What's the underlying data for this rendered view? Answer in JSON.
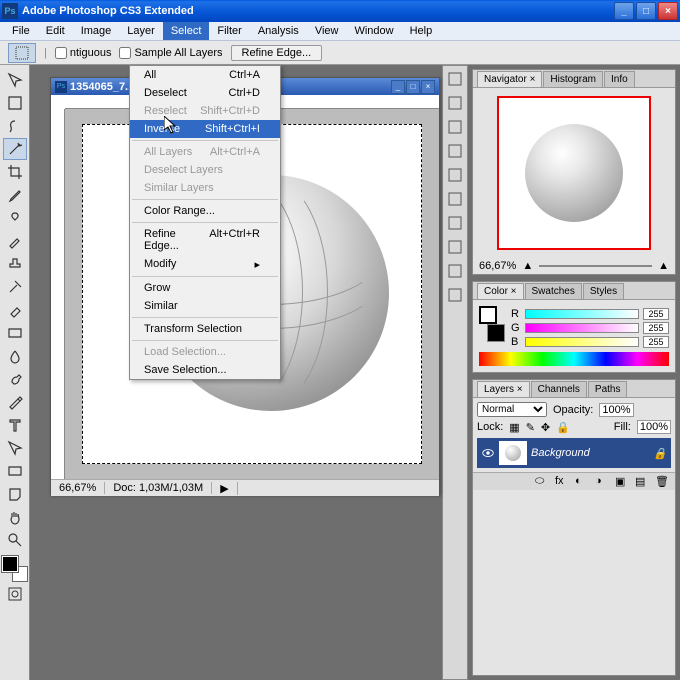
{
  "app": {
    "title": "Adobe Photoshop CS3 Extended",
    "icon": "Ps"
  },
  "menubar": [
    "File",
    "Edit",
    "Image",
    "Layer",
    "Select",
    "Filter",
    "Analysis",
    "View",
    "Window",
    "Help"
  ],
  "menubar_open_index": 4,
  "options": {
    "contiguous": "ntiguous",
    "sample_all": "Sample All Layers",
    "refine": "Refine Edge..."
  },
  "dropdown": [
    {
      "label": "All",
      "shortcut": "Ctrl+A"
    },
    {
      "label": "Deselect",
      "shortcut": "Ctrl+D"
    },
    {
      "label": "Reselect",
      "shortcut": "Shift+Ctrl+D",
      "disabled": true
    },
    {
      "label": "Inverse",
      "shortcut": "Shift+Ctrl+I",
      "highlight": true
    },
    {
      "sep": true
    },
    {
      "label": "All Layers",
      "shortcut": "Alt+Ctrl+A",
      "disabled": true
    },
    {
      "label": "Deselect Layers",
      "disabled": true
    },
    {
      "label": "Similar Layers",
      "disabled": true
    },
    {
      "sep": true
    },
    {
      "label": "Color Range..."
    },
    {
      "sep": true
    },
    {
      "label": "Refine Edge...",
      "shortcut": "Alt+Ctrl+R"
    },
    {
      "label": "Modify",
      "submenu": true
    },
    {
      "sep": true
    },
    {
      "label": "Grow"
    },
    {
      "label": "Similar"
    },
    {
      "sep": true
    },
    {
      "label": "Transform Selection"
    },
    {
      "sep": true
    },
    {
      "label": "Load Selection...",
      "disabled": true
    },
    {
      "label": "Save Selection..."
    }
  ],
  "doc": {
    "title": "1354065_7...",
    "zoom": "66,67%",
    "docsize": "Doc: 1,03M/1,03M"
  },
  "navigator": {
    "tabs": [
      "Navigator ×",
      "Histogram",
      "Info"
    ],
    "zoom": "66,67%"
  },
  "color": {
    "tabs": [
      "Color ×",
      "Swatches",
      "Styles"
    ],
    "channels": [
      {
        "l": "R",
        "v": "255"
      },
      {
        "l": "G",
        "v": "255"
      },
      {
        "l": "B",
        "v": "255"
      }
    ]
  },
  "layers": {
    "tabs": [
      "Layers ×",
      "Channels",
      "Paths"
    ],
    "blend": "Normal",
    "opacity_lbl": "Opacity:",
    "opacity": "100%",
    "lock_lbl": "Lock:",
    "fill_lbl": "Fill:",
    "fill": "100%",
    "layer_name": "Background"
  }
}
